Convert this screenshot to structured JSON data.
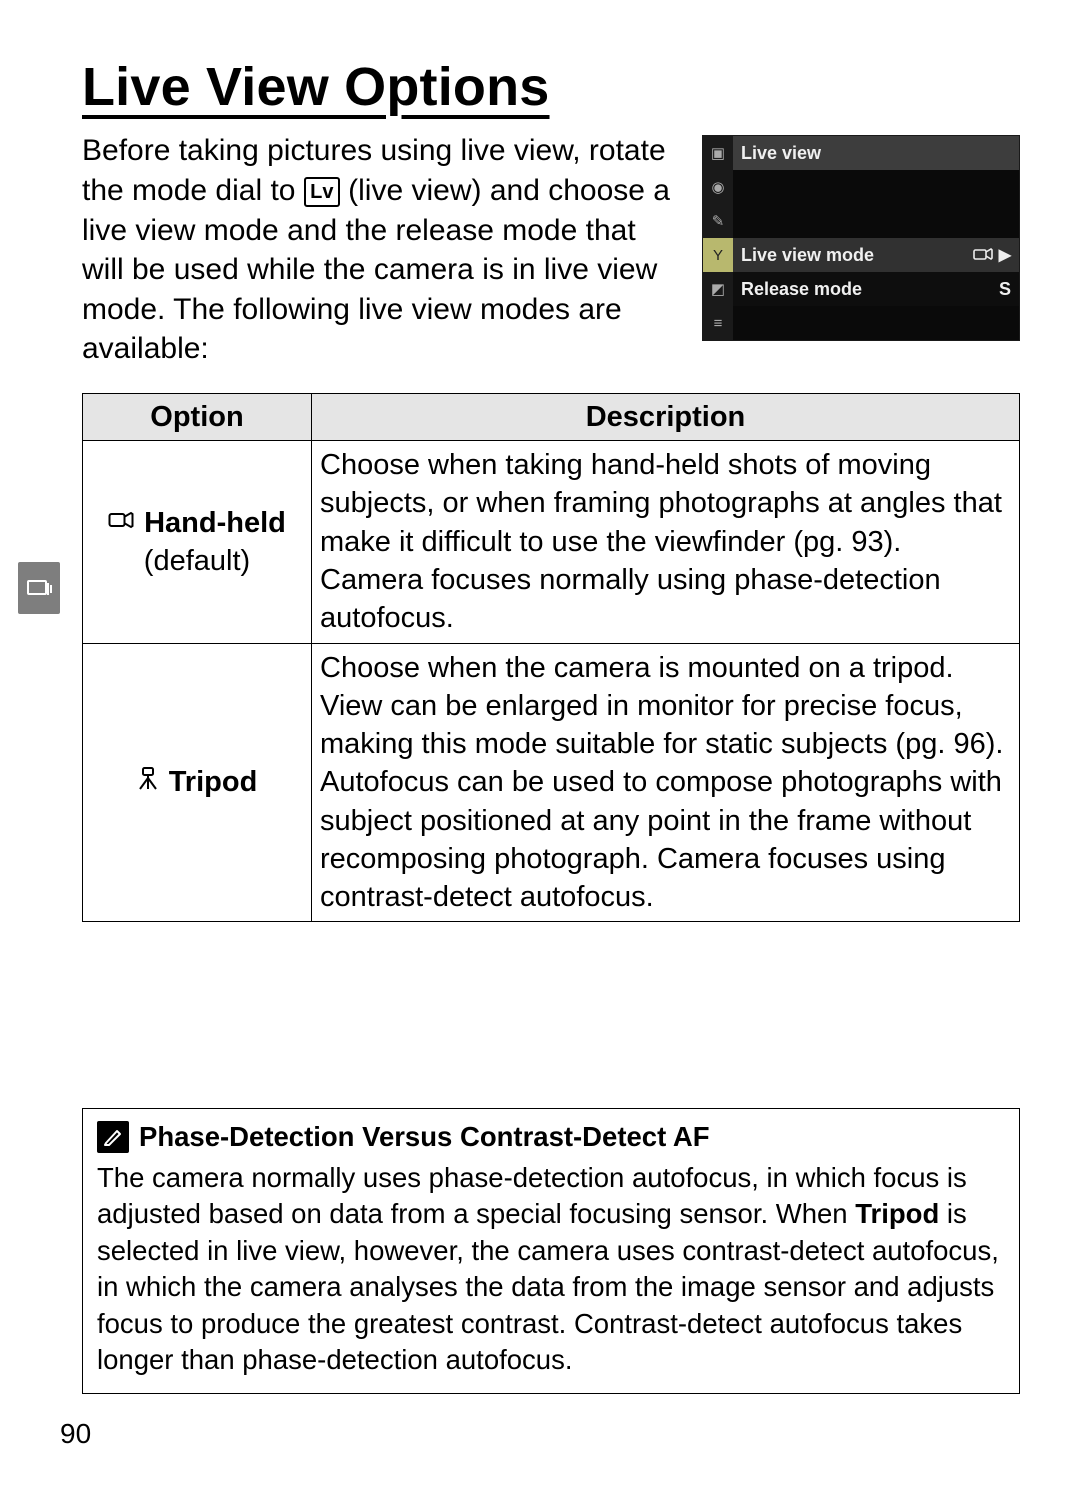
{
  "title": "Live View Options",
  "intro": {
    "pre": "Before taking pictures using live view, rotate the mode dial to ",
    "lv_glyph": "Lv",
    "post": " (live view) and choose a live view mode and the release mode that will be used while the camera is in live view mode.  The following live view modes are available:"
  },
  "menu": {
    "title": "Live view",
    "rows": {
      "lv_mode_label": "Live view mode",
      "release_label": "Release mode",
      "release_value": "S"
    }
  },
  "table": {
    "headers": {
      "option": "Option",
      "desc": "Description"
    },
    "rows": [
      {
        "label": "Hand-held",
        "sub": "(default)",
        "icon": "hand-held-icon",
        "desc": "Choose when taking hand-held shots of moving subjects, or when framing photographs at angles that make it difficult to use the viewfinder (pg. 93).  Camera focuses normally using phase-detection autofocus."
      },
      {
        "label": "Tripod",
        "sub": "",
        "icon": "tripod-icon",
        "desc": "Choose when the camera is mounted on a tripod.  View can be enlarged in monitor for precise focus, making this mode suitable for static subjects (pg. 96).  Autofocus can be used to compose photographs with subject positioned at any point in the frame without recomposing photograph.  Camera focuses using contrast-detect autofocus."
      }
    ]
  },
  "callout": {
    "title": "Phase-Detection Versus Contrast-Detect AF",
    "body_pre": "The camera normally uses phase-detection autofocus, in which focus is adjusted based on data from a special focusing sensor.  When ",
    "body_bold": "Tripod",
    "body_post": " is selected in live view, however, the camera uses contrast-detect autofocus, in which the camera analyses the data from the image sensor and adjusts focus to produce the greatest contrast.  Contrast-detect autofocus takes longer than phase-detection autofocus."
  },
  "page_number": "90"
}
